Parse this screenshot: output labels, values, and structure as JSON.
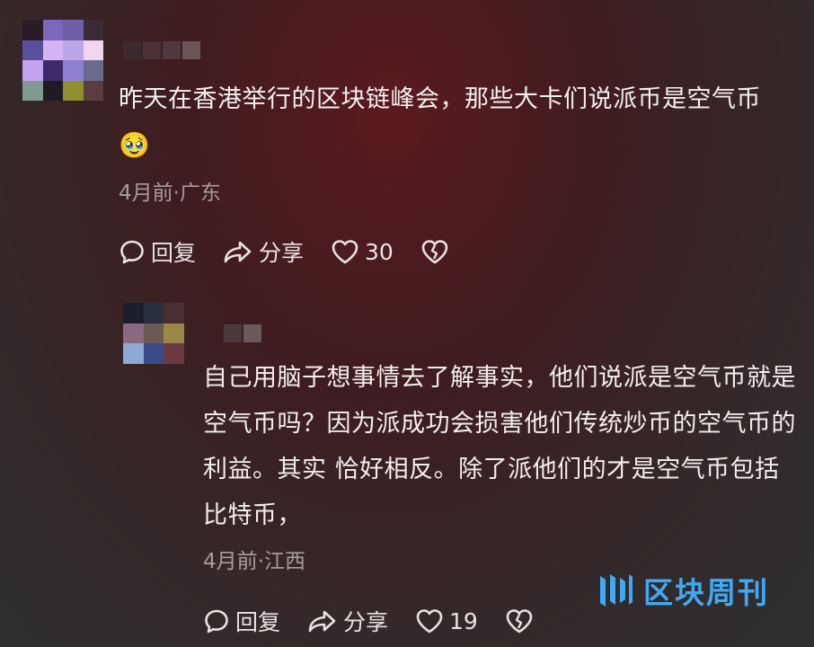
{
  "comments": [
    {
      "text": "昨天在香港举行的区块链峰会，那些大卡们说派币是空气币",
      "emoji": "🥹",
      "meta": "4月前·广东",
      "actions": {
        "reply": "回复",
        "share": "分享",
        "likes": "30"
      },
      "avatar_colors": [
        "#2a1c27",
        "#7c67ba",
        "#6e5ea8",
        "#3c2a35",
        "#5a4f9c",
        "#d4b3f2",
        "#bba6e8",
        "#f2d5f0",
        "#c6a3ef",
        "#3d2a6a",
        "#8f7fd2",
        "#6a6a8a",
        "#7f9a90",
        "#1e1b25",
        "#8f8f30",
        "#5a3d3f"
      ],
      "username_colors": [
        "#3c2a30",
        "#4a3236",
        "#4e3a3e",
        "#6b5557"
      ]
    },
    {
      "text": "自己用脑子想事情去了解事实，他们说派是空气币就是空气币吗？因为派成功会损害他们传统炒币的空气币的利益。其实 恰好相反。除了派他们的才是空气币包括比特币，",
      "meta": "4月前·江西",
      "actions": {
        "reply": "回复",
        "share": "分享",
        "likes": "19"
      },
      "avatar_colors": [
        "#1c1f2a",
        "#2a2f3f",
        "#4a2f32",
        "#8a6a82",
        "#6a5a52",
        "#9a8848",
        "#8caad4",
        "#3b4a8a",
        "#6a3a3e"
      ],
      "username_colors": [
        "#4a3a3c",
        "#6a5a5c"
      ]
    }
  ],
  "watermark": {
    "text": "区块周刊",
    "color": "#3fa9f5"
  }
}
